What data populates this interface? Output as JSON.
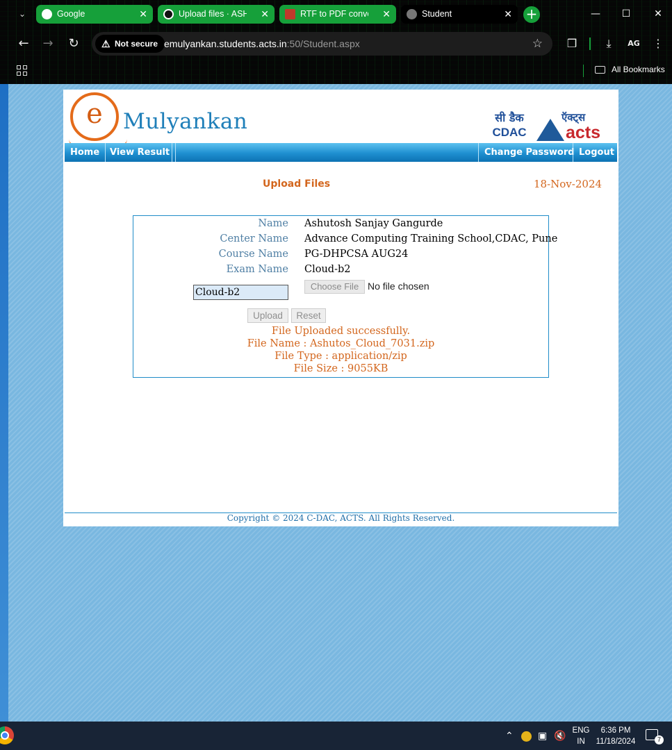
{
  "browser": {
    "tabs": [
      {
        "title": "Google",
        "state": "pinned-green"
      },
      {
        "title": "Upload files · ASHUTOSH",
        "state": "green"
      },
      {
        "title": "RTF to PDF converter",
        "state": "green"
      },
      {
        "title": "Student",
        "state": "active"
      }
    ],
    "security_label": "Not secure",
    "url_host": "emulyankan.students.acts.in",
    "url_rest": ":50/Student.aspx",
    "all_bookmarks": "All Bookmarks",
    "profile_initials": "AG",
    "accent_color": "#16a03a"
  },
  "site": {
    "logo_letter": "e",
    "logo_text": "Mulyankan",
    "cdac_hindi": "सी डैक",
    "cdac_english": "CDAC",
    "acts_hindi": "ऍक्ट्स",
    "acts_english": "acts",
    "menu": {
      "home": "Home",
      "view_result": "View Result",
      "change_password": "Change Password",
      "logout": "Logout"
    },
    "heading": "Upload Files",
    "date": "18-Nov-2024",
    "fields": [
      {
        "label": "Name",
        "value": "Ashutosh Sanjay Gangurde"
      },
      {
        "label": "Center Name",
        "value": "Advance Computing Training School,CDAC, Pune"
      },
      {
        "label": "Course Name",
        "value": "PG-DHPCSA AUG24"
      },
      {
        "label": "Exam Name",
        "value": "Cloud-b2"
      }
    ],
    "exam_input_value": "Cloud-b2",
    "choose_file_label": "Choose File",
    "no_file_label": "No file chosen",
    "upload_label": "Upload",
    "reset_label": "Reset",
    "messages": {
      "status": "File Uploaded successfully.",
      "file_name": "File Name : Ashutos_Cloud_7031.zip",
      "file_type": "File Type : application/zip",
      "file_size": "File Size : 9055KB"
    },
    "footer": "Copyright © 2024 C-DAC, ACTS. All Rights Reserved.",
    "brand_orange": "#d3661d",
    "brand_blue": "#1f8cc8"
  },
  "taskbar": {
    "lang_top": "ENG",
    "lang_bottom": "IN",
    "time": "6:36 PM",
    "date": "11/18/2024",
    "notification_count": "7"
  }
}
